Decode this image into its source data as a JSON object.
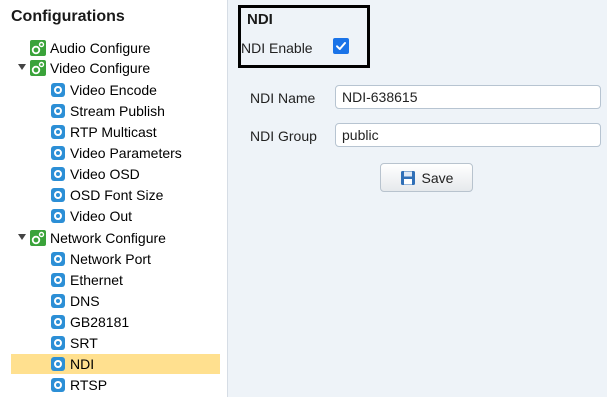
{
  "sidebar": {
    "title": "Configurations",
    "items": [
      {
        "label": "Audio Configure",
        "icon": "green-gear-icon",
        "level": 1
      },
      {
        "label": "Video Configure",
        "icon": "green-gear-icon",
        "level": 1,
        "expanded": true
      },
      {
        "label": "Video Encode",
        "icon": "blue-gear-icon",
        "level": 2
      },
      {
        "label": "Stream Publish",
        "icon": "blue-gear-icon",
        "level": 2
      },
      {
        "label": "RTP Multicast",
        "icon": "blue-gear-icon",
        "level": 2
      },
      {
        "label": "Video Parameters",
        "icon": "blue-gear-icon",
        "level": 2
      },
      {
        "label": "Video OSD",
        "icon": "blue-gear-icon",
        "level": 2
      },
      {
        "label": "OSD Font Size",
        "icon": "blue-gear-icon",
        "level": 2
      },
      {
        "label": "Video Out",
        "icon": "blue-gear-icon",
        "level": 2
      },
      {
        "label": "Network Configure",
        "icon": "green-gear-icon",
        "level": 1,
        "expanded": true
      },
      {
        "label": "Network Port",
        "icon": "blue-gear-icon",
        "level": 2
      },
      {
        "label": "Ethernet",
        "icon": "blue-gear-icon",
        "level": 2
      },
      {
        "label": "DNS",
        "icon": "blue-gear-icon",
        "level": 2
      },
      {
        "label": "GB28181",
        "icon": "blue-gear-icon",
        "level": 2
      },
      {
        "label": "SRT",
        "icon": "blue-gear-icon",
        "level": 2
      },
      {
        "label": "NDI",
        "icon": "blue-gear-icon",
        "level": 2,
        "selected": true
      },
      {
        "label": "RTSP",
        "icon": "blue-gear-icon",
        "level": 2
      }
    ]
  },
  "panel": {
    "title": "NDI",
    "enable_label": "NDI Enable",
    "enable_checked": true,
    "name_label": "NDI Name",
    "name_value": "NDI-638615",
    "group_label": "NDI Group",
    "group_value": "public",
    "save_label": "Save"
  },
  "colors": {
    "selected_bg": "#ffe08f",
    "panel_bg": "#eef3f8",
    "checkbox": "#1a73e8",
    "blue_gear": "#2c8fd6",
    "green_gear": "#3aa33a"
  }
}
